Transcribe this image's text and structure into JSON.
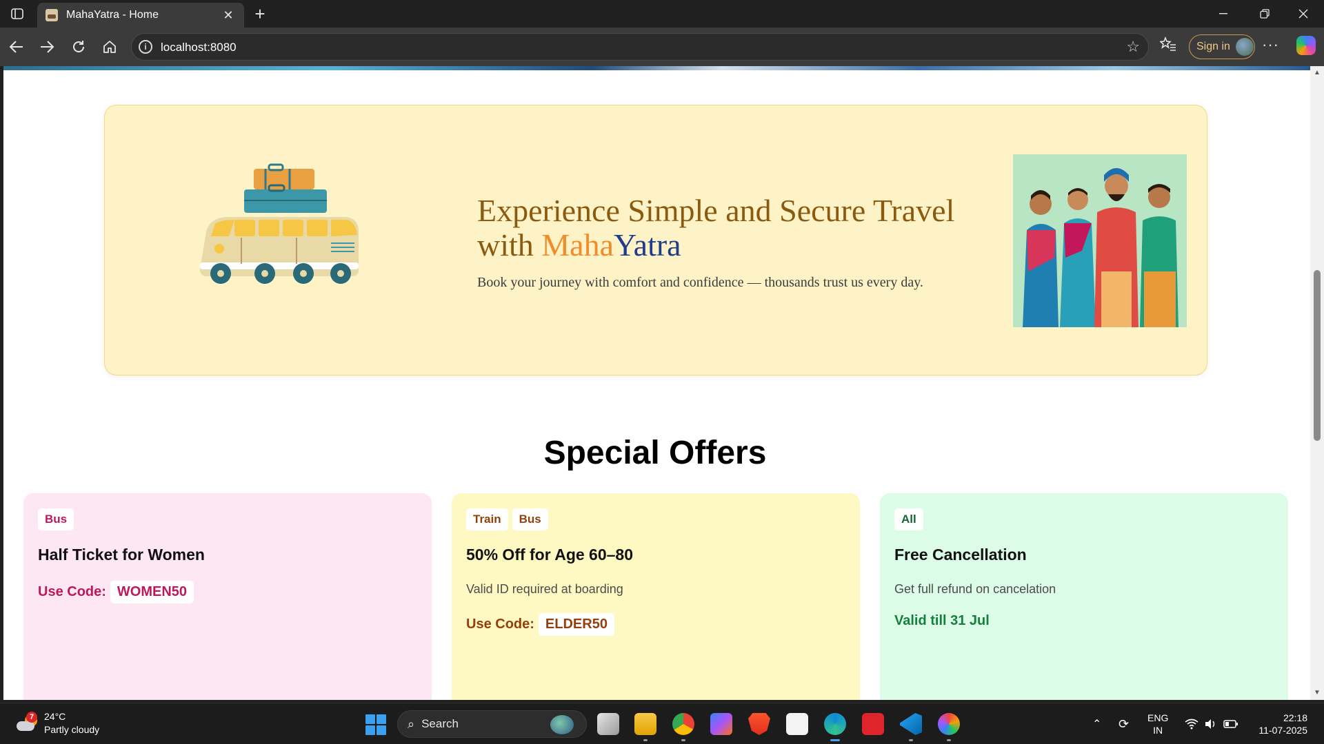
{
  "browser": {
    "tab_title": "MahaYatra - Home",
    "new_tab_symbol": "+",
    "url": "localhost:8080",
    "sign_in_label": "Sign in"
  },
  "hero": {
    "title_line1": "Experience Simple and Secure Travel",
    "title_prefix": "with ",
    "brand_part1": "Maha",
    "brand_part2": "Yatra",
    "subtitle": "Book your journey with comfort and confidence — thousands trust us every day."
  },
  "offers": {
    "section_title": "Special Offers",
    "cards": [
      {
        "tags": [
          "Bus"
        ],
        "title": "Half Ticket for Women",
        "code_label": "Use Code:",
        "code": "WOMEN50"
      },
      {
        "tags": [
          "Train",
          "Bus"
        ],
        "title": "50% Off for Age 60–80",
        "description": "Valid ID required at boarding",
        "code_label": "Use Code:",
        "code": "ELDER50"
      },
      {
        "tags": [
          "All"
        ],
        "title": "Free Cancellation",
        "description": "Get full refund on cancelation",
        "validity": "Valid till 31 Jul"
      }
    ]
  },
  "taskbar": {
    "weather_temp": "24°C",
    "weather_desc": "Partly cloudy",
    "weather_badge": "7",
    "search_label": "Search",
    "lang_line1": "ENG",
    "lang_line2": "IN",
    "time": "22:18",
    "date": "11-07-2025"
  },
  "colors": {
    "hero_bg": "#fef3c7",
    "brand_maha": "#f28c28",
    "brand_yatra": "#1f3d8a",
    "card_pink": "#fce7f3",
    "card_yellow": "#fef9c3",
    "card_green": "#dcfce7"
  }
}
